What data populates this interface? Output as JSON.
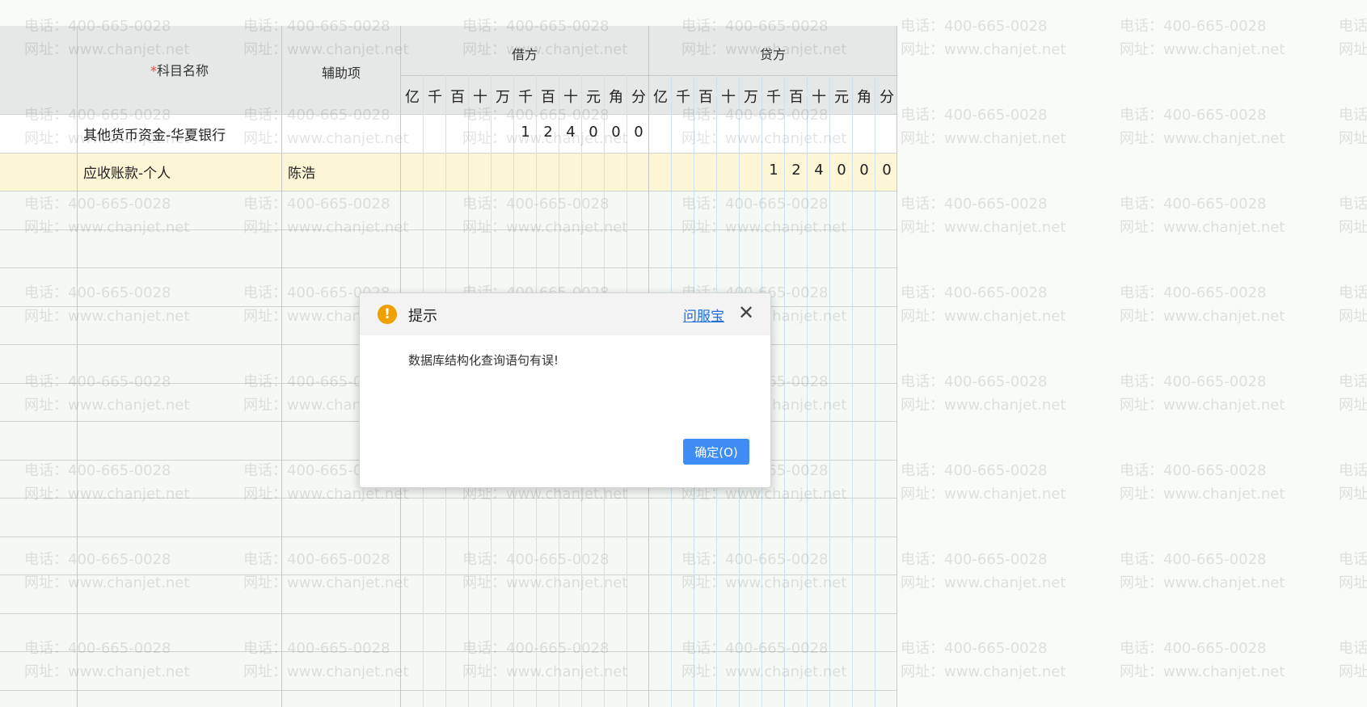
{
  "watermark": {
    "line1": "电话：400-665-0028",
    "line2": "网址：www.chanjet.net"
  },
  "table": {
    "headers": {
      "subject": "科目名称",
      "required_mark": "*",
      "auxiliary": "辅助项",
      "debit": "借方",
      "credit": "贷方"
    },
    "units": [
      "亿",
      "千",
      "百",
      "十",
      "万",
      "千",
      "百",
      "十",
      "元",
      "角",
      "分"
    ],
    "rows": [
      {
        "subject": "其他货币资金-华夏银行",
        "auxiliary": "",
        "debit_digits": [
          "",
          "",
          "",
          "",
          "",
          "1",
          "2",
          "4",
          "0",
          "0",
          "0"
        ],
        "credit_digits": [
          "",
          "",
          "",
          "",
          "",
          "",
          "",
          "",
          "",
          "",
          ""
        ]
      },
      {
        "subject": "应收账款-个人",
        "auxiliary": "陈浩",
        "debit_digits": [
          "",
          "",
          "",
          "",
          "",
          "",
          "",
          "",
          "",
          "",
          ""
        ],
        "credit_digits": [
          "",
          "",
          "",
          "",
          "",
          "1",
          "2",
          "4",
          "0",
          "0",
          "0"
        ]
      }
    ]
  },
  "dialog": {
    "title": "提示",
    "help_link": "问服宝",
    "close_icon": "close-icon",
    "warning_icon": "exclamation-icon",
    "warning_color": "#f0a000",
    "message": "数据库结构化查询语句有误!",
    "ok_label": "确定(O)",
    "ok_color": "#3f8cf4"
  }
}
